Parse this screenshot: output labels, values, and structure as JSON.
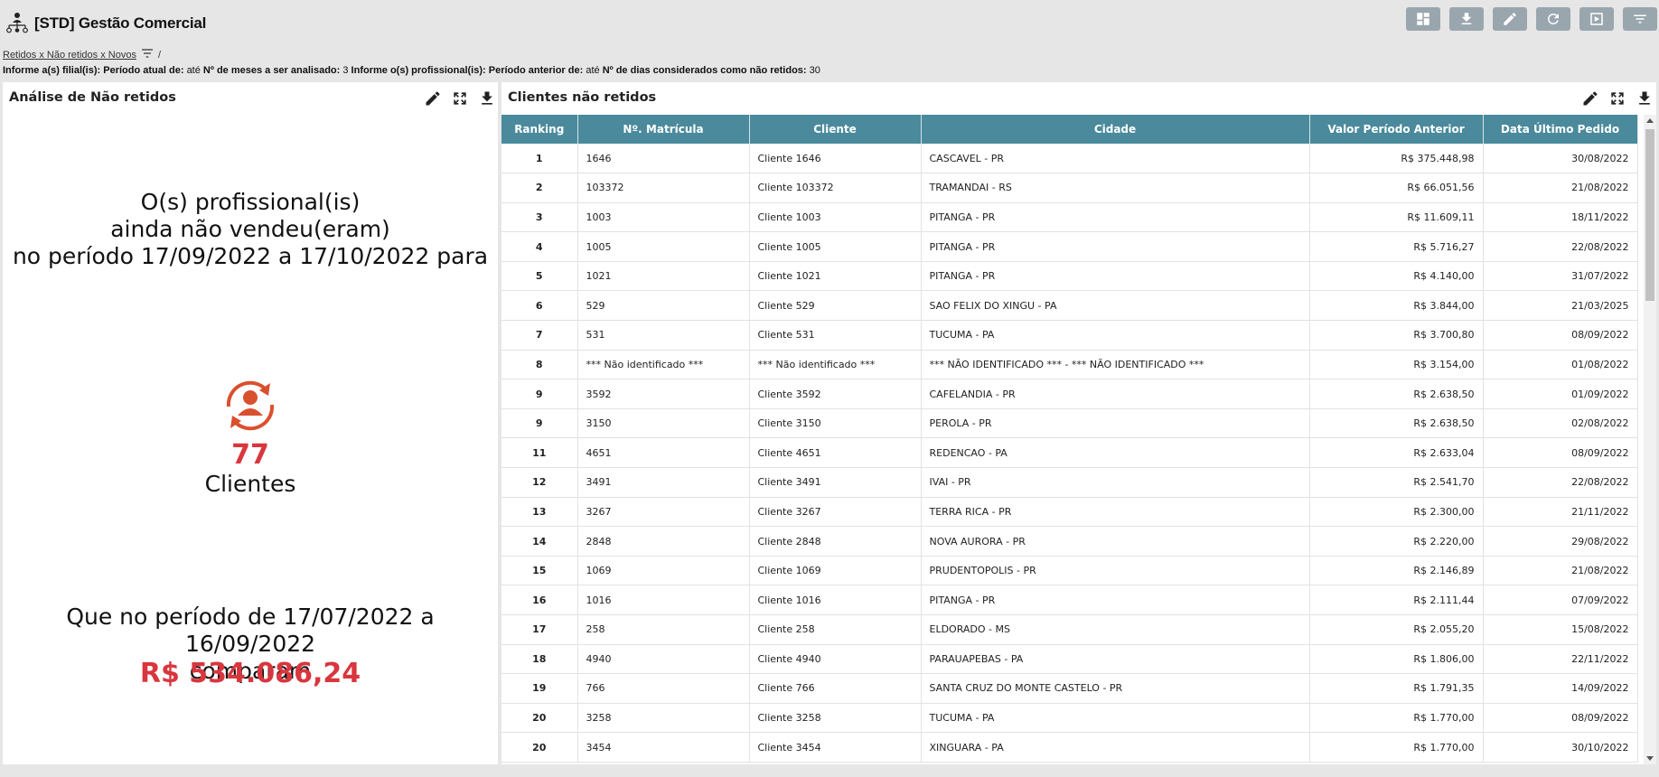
{
  "app": {
    "title": "[STD] Gestão Comercial",
    "logo_icon": "org-chart-icon"
  },
  "toolbar": [
    "dashboard-icon",
    "download-icon",
    "edit-icon",
    "refresh-icon",
    "play-icon",
    "filter-icon"
  ],
  "breadcrumb": {
    "link": "Retidos x Não retidos x Novos",
    "separator": "/"
  },
  "filters": [
    {
      "label": "Informe a(s) filial(is):",
      "value": ""
    },
    {
      "label": "Período atual de:",
      "value": "até"
    },
    {
      "label": "Nº de meses a ser analisado:",
      "value": "3"
    },
    {
      "label": "Informe o(s) profissional(is):",
      "value": ""
    },
    {
      "label": "Período anterior de:",
      "value": "até"
    },
    {
      "label": "Nº de dias considerados como não retidos:",
      "value": "30"
    }
  ],
  "left_panel": {
    "title": "Análise de Não retidos",
    "line1": "O(s) profissional(is)",
    "line2": "ainda não vendeu(eram)",
    "line3": "no período 17/09/2022 a 17/10/2022 para",
    "count": "77",
    "count_label": "Clientes",
    "line4": "Que no período de 17/07/2022 a 16/09/2022",
    "line5": "comparam",
    "total": "R$ 534.086,24",
    "accent_color": "#d9363e"
  },
  "right_panel": {
    "title": "Clientes não retidos",
    "header_color": "#4a8a9c",
    "columns": [
      "Ranking",
      "Nº. Matrícula",
      "Cliente",
      "Cidade",
      "Valor Período Anterior",
      "Data Último Pedido"
    ],
    "rows": [
      [
        "1",
        "1646",
        "Cliente 1646",
        "CASCAVEL - PR",
        "R$ 375.448,98",
        "30/08/2022"
      ],
      [
        "2",
        "103372",
        "Cliente 103372",
        "TRAMANDAI - RS",
        "R$ 66.051,56",
        "21/08/2022"
      ],
      [
        "3",
        "1003",
        "Cliente 1003",
        "PITANGA - PR",
        "R$ 11.609,11",
        "18/11/2022"
      ],
      [
        "4",
        "1005",
        "Cliente 1005",
        "PITANGA - PR",
        "R$ 5.716,27",
        "22/08/2022"
      ],
      [
        "5",
        "1021",
        "Cliente 1021",
        "PITANGA - PR",
        "R$ 4.140,00",
        "31/07/2022"
      ],
      [
        "6",
        "529",
        "Cliente 529",
        "SAO FELIX DO XINGU - PA",
        "R$ 3.844,00",
        "21/03/2025"
      ],
      [
        "7",
        "531",
        "Cliente 531",
        "TUCUMA - PA",
        "R$ 3.700,80",
        "08/09/2022"
      ],
      [
        "8",
        "*** Não identificado ***",
        "*** Não identificado ***",
        "*** NÃO IDENTIFICADO *** - *** NÃO IDENTIFICADO ***",
        "R$ 3.154,00",
        "01/08/2022"
      ],
      [
        "9",
        "3592",
        "Cliente 3592",
        "CAFELANDIA - PR",
        "R$ 2.638,50",
        "01/09/2022"
      ],
      [
        "9",
        "3150",
        "Cliente 3150",
        "PEROLA - PR",
        "R$ 2.638,50",
        "02/08/2022"
      ],
      [
        "11",
        "4651",
        "Cliente 4651",
        "REDENCAO - PA",
        "R$ 2.633,04",
        "08/09/2022"
      ],
      [
        "12",
        "3491",
        "Cliente 3491",
        "IVAI - PR",
        "R$ 2.541,70",
        "22/08/2022"
      ],
      [
        "13",
        "3267",
        "Cliente 3267",
        "TERRA RICA - PR",
        "R$ 2.300,00",
        "21/11/2022"
      ],
      [
        "14",
        "2848",
        "Cliente 2848",
        "NOVA AURORA - PR",
        "R$ 2.220,00",
        "29/08/2022"
      ],
      [
        "15",
        "1069",
        "Cliente 1069",
        "PRUDENTOPOLIS - PR",
        "R$ 2.146,89",
        "21/08/2022"
      ],
      [
        "16",
        "1016",
        "Cliente 1016",
        "PITANGA - PR",
        "R$ 2.111,44",
        "07/09/2022"
      ],
      [
        "17",
        "258",
        "Cliente 258",
        "ELDORADO - MS",
        "R$ 2.055,20",
        "15/08/2022"
      ],
      [
        "18",
        "4940",
        "Cliente 4940",
        "PARAUAPEBAS - PA",
        "R$ 1.806,00",
        "22/11/2022"
      ],
      [
        "19",
        "766",
        "Cliente 766",
        "SANTA CRUZ DO MONTE CASTELO - PR",
        "R$ 1.791,35",
        "14/09/2022"
      ],
      [
        "20",
        "3258",
        "Cliente 3258",
        "TUCUMA - PA",
        "R$ 1.770,00",
        "08/09/2022"
      ],
      [
        "20",
        "3454",
        "Cliente 3454",
        "XINGUARA - PA",
        "R$ 1.770,00",
        "30/10/2022"
      ]
    ]
  }
}
